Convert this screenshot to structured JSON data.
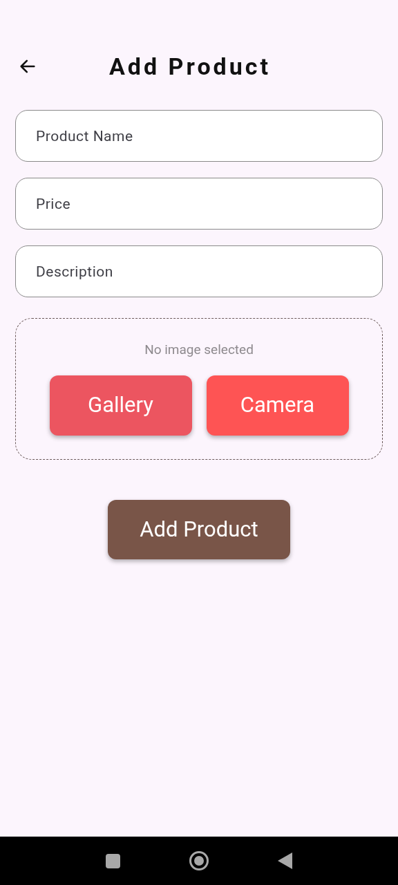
{
  "header": {
    "title": "Add Product"
  },
  "fields": [
    {
      "placeholder": "Product Name"
    },
    {
      "placeholder": "Price"
    },
    {
      "placeholder": "Description"
    }
  ],
  "image_picker": {
    "status": "No image selected",
    "buttons": [
      {
        "label": "Gallery",
        "color": "#ec5560"
      },
      {
        "label": "Camera",
        "color": "#fe5454"
      }
    ]
  },
  "submit_button": {
    "label": "Add Product"
  }
}
